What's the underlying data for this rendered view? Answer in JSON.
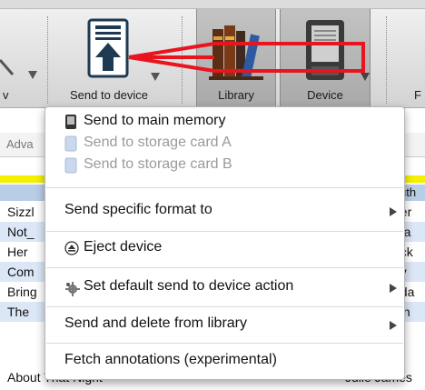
{
  "toolbar": {
    "send_label": "Send to device",
    "library_label": "Library",
    "device_label": "Device",
    "left_partial_label": "v",
    "right_partial_label": "F"
  },
  "search": {
    "partial_text": "Adva"
  },
  "header": {
    "right_partial": "uth"
  },
  "rows": [
    {
      "left": "Sizzl",
      "right": "her",
      "alt": false
    },
    {
      "left": "Not_",
      "right": "ma",
      "alt": true
    },
    {
      "left": "Her",
      "right": "ock",
      "alt": false
    },
    {
      "left": "Com",
      "right": "ey",
      "alt": true
    },
    {
      "left": "Bring",
      "right": "nda",
      "alt": false
    },
    {
      "left": "The",
      "right": "len",
      "alt": true
    },
    {
      "left": "About That Night",
      "right": "Julie James",
      "alt": false
    }
  ],
  "menu": {
    "send_main": "Send to main memory",
    "send_card_a": "Send to storage card A",
    "send_card_b": "Send to storage card B",
    "send_specific": "Send specific format to",
    "eject": "Eject device",
    "set_default": "Set default send to device action",
    "send_delete": "Send and delete from library",
    "fetch": "Fetch annotations (experimental)"
  },
  "colors": {
    "annotation_red": "#e8141e",
    "selection_blue": "#b8cde6",
    "highlight_yellow": "#f4f000"
  },
  "icons": {
    "send": "send-to-device-icon",
    "library": "books-icon",
    "device": "ereader-icon",
    "eject": "eject-icon",
    "gear": "gear-icon"
  }
}
